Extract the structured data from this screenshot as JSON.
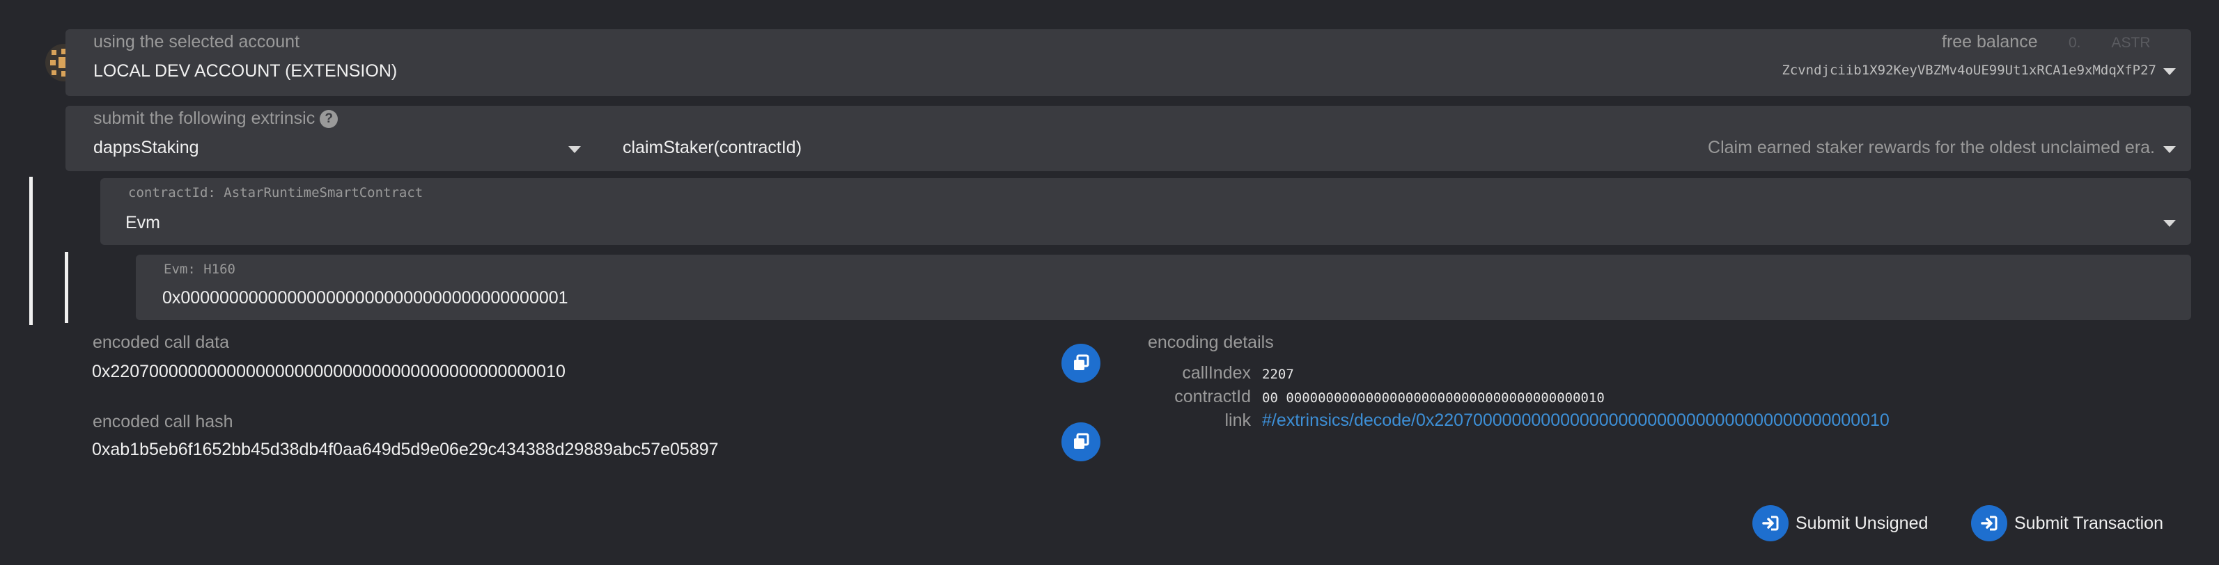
{
  "account": {
    "label": "using the selected account",
    "name": "LOCAL DEV ACCOUNT (EXTENSION)",
    "balance_label": "free balance",
    "balance_value": "0.",
    "balance_unit": "ASTR",
    "address": "Zcvndjciib1X92KeyVBZMv4oUE99Ut1xRCA1e9xMdqXfP27",
    "icon": "account-identicon"
  },
  "extrinsic": {
    "label": "submit the following extrinsic",
    "help_icon": "?",
    "section": "dappsStaking",
    "method": "claimStaker(contractId)",
    "description": "Claim earned staker rewards for the oldest unclaimed era."
  },
  "param": {
    "label": "contractId: AstarRuntimeSmartContract",
    "value": "Evm",
    "sub_label": "Evm: H160",
    "sub_value": "0x0000000000000000000000000000000000000001"
  },
  "encoded": {
    "call_data_label": "encoded call data",
    "call_data": "0x22070000000000000000000000000000000000000000010",
    "call_hash_label": "encoded call hash",
    "call_hash": "0xab1b5eb6f1652bb45d38db4f0aa649d5d9e06e29c434388d29889abc57e05897"
  },
  "details": {
    "title": "encoding details",
    "rows": [
      {
        "key": "callIndex",
        "value": "2207"
      },
      {
        "key": "contractId",
        "value": "00 0000000000000000000000000000000000000010"
      },
      {
        "key": "link",
        "value": "#/extrinsics/decode/0x22070000000000000000000000000000000000000000010"
      }
    ]
  },
  "actions": {
    "submit_unsigned": "Submit Unsigned",
    "submit_transaction": "Submit Transaction"
  },
  "colors": {
    "background": "#26272c",
    "panel": "#3a3b40",
    "accent": "#1e6fcf",
    "link": "#3d8fd6"
  }
}
